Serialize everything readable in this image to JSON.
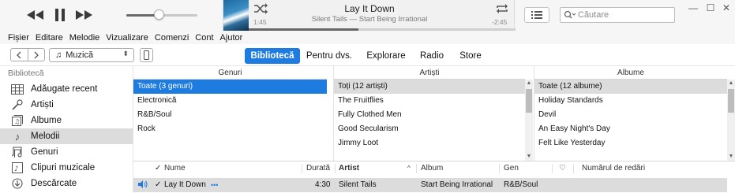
{
  "player": {
    "now_playing_title": "Lay It Down",
    "now_playing_subtitle": "Silent Tails — Start Being Irrational",
    "elapsed": "1:45",
    "remaining": "-2:45",
    "progress_fraction": 0.41,
    "volume_fraction": 0.45
  },
  "search": {
    "placeholder": "Căutare"
  },
  "menu": [
    "Fișier",
    "Editare",
    "Melodie",
    "Vizualizare",
    "Comenzi",
    "Cont",
    "Ajutor"
  ],
  "toolbar": {
    "media_kind": "Muzică",
    "tabs": [
      {
        "label": "Bibliotecă",
        "active": true
      },
      {
        "label": "Pentru dvs.",
        "active": false
      },
      {
        "label": "Explorare",
        "active": false
      },
      {
        "label": "Radio",
        "active": false
      },
      {
        "label": "Store",
        "active": false
      }
    ]
  },
  "sidebar": {
    "heading": "Bibliotecă",
    "items": [
      {
        "label": "Adăugate recent",
        "icon": "grid-icon"
      },
      {
        "label": "Artiști",
        "icon": "microphone-icon"
      },
      {
        "label": "Albume",
        "icon": "album-icon"
      },
      {
        "label": "Melodii",
        "icon": "music-note-icon",
        "active": true
      },
      {
        "label": "Genuri",
        "icon": "genre-icon"
      },
      {
        "label": "Clipuri muzicale",
        "icon": "music-video-icon"
      },
      {
        "label": "Descărcate",
        "icon": "download-icon"
      }
    ]
  },
  "browser": {
    "genres": {
      "header": "Genuri",
      "items": [
        "Toate (3 genuri)",
        "Electronică",
        "R&B/Soul",
        "Rock"
      ]
    },
    "artists": {
      "header": "Artiști",
      "items": [
        "Toți (12 artiști)",
        "The Fruitflies",
        "Fully Clothed Men",
        "Good Secularism",
        "Jimmy Loot"
      ]
    },
    "albums": {
      "header": "Albume",
      "items": [
        "Toate (12 albume)",
        "Holiday Standards",
        "Devil",
        "An Easy Night's Day",
        "Felt Like Yesterday"
      ]
    }
  },
  "songs": {
    "columns": {
      "check": "✓",
      "name": "Nume",
      "duration": "Durată",
      "artist": "Artist",
      "album": "Album",
      "genre": "Gen",
      "love": "♡",
      "plays": "Numărul de redări"
    },
    "rows": [
      {
        "check": "✓",
        "name": "Lay It Down",
        "more": "•••",
        "duration": "4:30",
        "artist": "Silent Tails",
        "album": "Start Being Irrational",
        "genre": "R&B/Soul"
      }
    ]
  },
  "colors": {
    "accent": "#1e7be0",
    "selected_gray": "#dcdcdc"
  }
}
